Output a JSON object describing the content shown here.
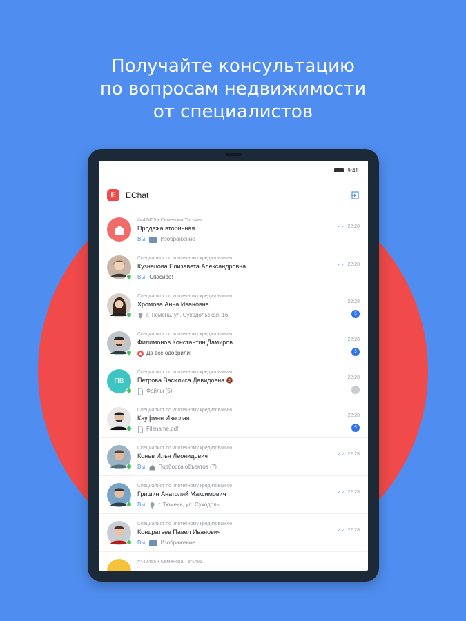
{
  "headline": {
    "line1": "Получайте консультацию",
    "line2": "по вопросам недвижимости",
    "line3": "от специалистов"
  },
  "statusbar": {
    "time": "9:41"
  },
  "appbar": {
    "logo_letter": "E",
    "title": "EChat"
  },
  "colors": {
    "background": "#4f8ef0",
    "circle": "#f04a4a",
    "accent": "#2f74e8",
    "online": "#3cc35c"
  },
  "chats": [
    {
      "subtitle": "#442455 • Семенова Татьяна",
      "name": "Продажа вторичная",
      "you": "Вы:",
      "preview": "Изображение",
      "time": "22:28",
      "read": true
    },
    {
      "subtitle": "Специалист по ипотечному кредитованию",
      "name": "Кузнецова Елизавета Александровна",
      "you": "Вы:",
      "preview": "Спасибо!",
      "time": "22:28",
      "read": true
    },
    {
      "subtitle": "Специалист по ипотечному кредитованию",
      "name": "Хромова Анна Ивановна",
      "preview": "г. Тюмень, ул. Суходольская, 16",
      "time": "22:28",
      "badge": "5"
    },
    {
      "subtitle": "Специалист по ипотечному кредитованию",
      "name": "Филимонов Константин Дамиров",
      "preview": "Да все одобрили!",
      "time": "22:28",
      "badge": "5"
    },
    {
      "subtitle": "Специалист по ипотечному кредитованию",
      "name": "Петрова Василиса Давидовна",
      "initials": "ПВ",
      "preview": "Файлы (5)",
      "time": "22:28",
      "muted": true
    },
    {
      "subtitle": "Специалист по ипотечному кредитованию",
      "name": "Кауфман Изяслав",
      "preview": "Filename.pdf",
      "time": "22:28",
      "badge": "5"
    },
    {
      "subtitle": "Специалист по ипотечному кредитованию",
      "name": "Конев Илья Леонидович",
      "you": "Вы:",
      "preview": "Подборка объектов (7)",
      "time": "22:28",
      "read": true
    },
    {
      "subtitle": "Специалист по ипотечному кредитованию",
      "name": "Гришин Анатолий Максимович",
      "you": "Вы:",
      "preview": "г. Тюмень, ул. Суходоль...",
      "time": "22:28",
      "read": true
    },
    {
      "subtitle": "Специалист по ипотечному кредитованию",
      "name": "Кондратьев Павел Иванович",
      "you": "Вы:",
      "preview": "Изображение",
      "time": "22:28",
      "read": true
    },
    {
      "subtitle": "#442455 • Семенова Татьяна"
    }
  ]
}
